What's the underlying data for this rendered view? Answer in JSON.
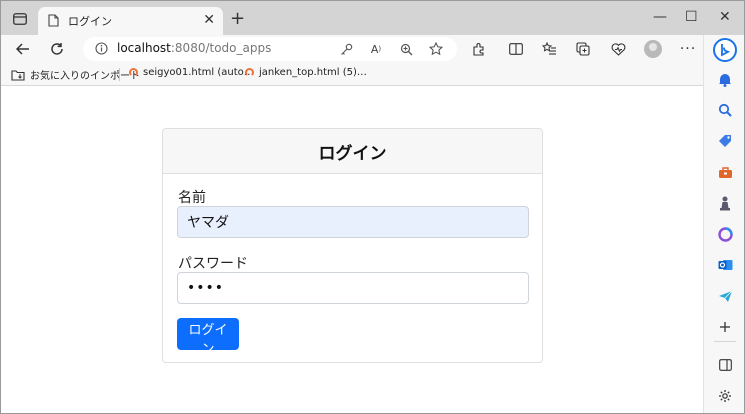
{
  "browser": {
    "tab": {
      "title": "ログイン",
      "close": "✕"
    },
    "new_tab": "+",
    "window_controls": {
      "minimize": "—",
      "maximize": "☐",
      "close": "✕"
    },
    "address": {
      "host": "localhost",
      "path": ":8080/todo_apps"
    },
    "bookmarks": [
      {
        "label": "お気に入りのインポート",
        "icon": "folder-import-icon"
      },
      {
        "label": "seigyo01.html (auto…",
        "icon": "loading-ring-icon"
      },
      {
        "label": "janken_top.html (5)…",
        "icon": "loading-ring-icon"
      }
    ],
    "sidebar_icons": [
      "bing-icon",
      "bell-icon",
      "search-icon",
      "tag-icon",
      "toolbox-icon",
      "chess-icon",
      "office-icon",
      "outlook-icon",
      "send-icon",
      "add-icon",
      "split-screen-icon",
      "settings-icon"
    ]
  },
  "login": {
    "title": "ログイン",
    "name_label": "名前",
    "name_value": "ヤマダ",
    "password_label": "パスワード",
    "password_value": "••••",
    "submit_label": "ログイン"
  },
  "colors": {
    "primary": "#0d6efd",
    "autofill": "#e8f0fe",
    "chrome": "#d4d4d4"
  }
}
